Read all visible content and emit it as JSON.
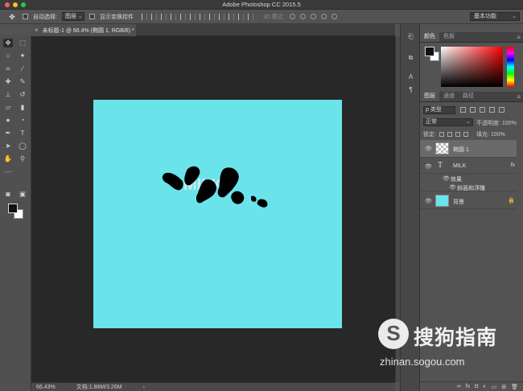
{
  "window": {
    "title": "Adobe Photoshop CC 2015.5"
  },
  "colors": {
    "canvas": "#6be3eb",
    "workspace": "#282828",
    "panel": "#535353"
  },
  "options": {
    "move_icon": "move-tool-icon",
    "auto_select_label": "自动选择:",
    "auto_select_value": "图层",
    "show_transform_label": "显示变换控件",
    "mode_3d_label": "3D 模式:",
    "workspace_value": "基本功能"
  },
  "document": {
    "tab_title": "未标题-1 @ 66.4% (椭圆 1, RGB/8) *"
  },
  "status": {
    "zoom": "66.43%",
    "doc_size": "文档:1.88M/3.26M"
  },
  "panels": {
    "color_tabs": [
      "颜色",
      "色板"
    ],
    "layer_tabs": [
      "图层",
      "通道",
      "路径"
    ],
    "filter_kind": "ρ 类型",
    "blend_mode": "正常",
    "opacity_label": "不透明度:",
    "opacity_value": "100%",
    "lock_label": "锁定:",
    "fill_label": "填充:",
    "fill_value": "100%",
    "layers": [
      {
        "name": "椭圆 1",
        "type": "shape",
        "selected": true
      },
      {
        "name": "MILK",
        "type": "text",
        "fx": "fx"
      },
      {
        "name": "背景",
        "type": "background",
        "locked": true
      }
    ],
    "effects_label": "效果",
    "bevel_label": "斜面和浮雕",
    "bottom_icons": [
      "link-icon",
      "fx-icon",
      "mask-icon",
      "adjustment-icon",
      "folder-icon",
      "new-layer-icon",
      "trash-icon"
    ],
    "bottom_fx_label": "fx"
  },
  "watermark": {
    "brand": "搜狗指南",
    "url": "zhinan.sogou.com",
    "logo_letter": "S"
  }
}
